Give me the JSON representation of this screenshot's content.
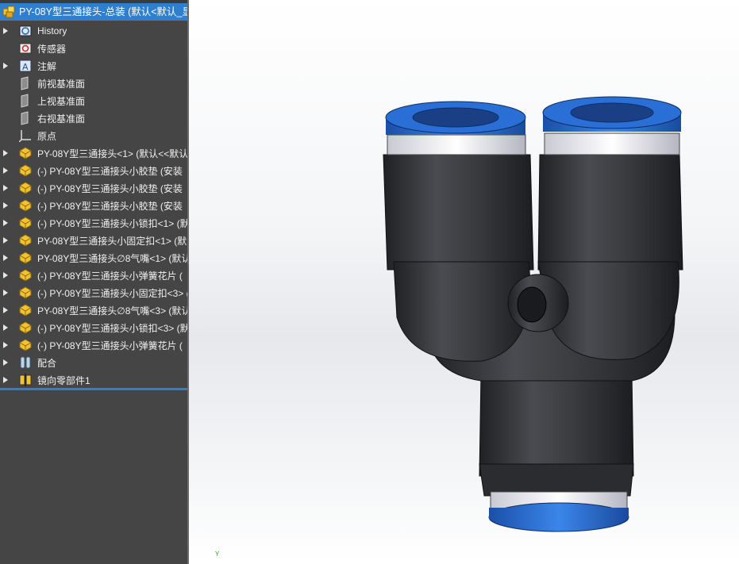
{
  "feature_tree": {
    "title": "PY-08Y型三通接头-总装 (默认<默认_显",
    "items": [
      {
        "label": "History",
        "icon": "history-icon",
        "expandable": true
      },
      {
        "label": "传感器",
        "icon": "sensor-icon",
        "expandable": false
      },
      {
        "label": "注解",
        "icon": "annotation-icon",
        "expandable": true
      },
      {
        "label": "前视基准面",
        "icon": "plane-icon",
        "expandable": false
      },
      {
        "label": "上视基准面",
        "icon": "plane-icon",
        "expandable": false
      },
      {
        "label": "右视基准面",
        "icon": "plane-icon",
        "expandable": false
      },
      {
        "label": "原点",
        "icon": "origin-icon",
        "expandable": false
      },
      {
        "label": "PY-08Y型三通接头<1> (默认<<默认",
        "icon": "part-icon",
        "expandable": true
      },
      {
        "label": "(-) PY-08Y型三通接头小胶垫 (安装",
        "icon": "part-icon",
        "expandable": true
      },
      {
        "label": "(-) PY-08Y型三通接头小胶垫 (安装",
        "icon": "part-icon",
        "expandable": true
      },
      {
        "label": "(-) PY-08Y型三通接头小胶垫 (安装",
        "icon": "part-icon",
        "expandable": true
      },
      {
        "label": "(-) PY-08Y型三通接头小锁扣<1> (默",
        "icon": "part-icon",
        "expandable": true
      },
      {
        "label": "PY-08Y型三通接头小固定扣<1> (默",
        "icon": "part-icon",
        "expandable": true
      },
      {
        "label": "PY-08Y型三通接头∅8气嘴<1> (默认",
        "icon": "part-icon",
        "expandable": true
      },
      {
        "label": "(-) PY-08Y型三通接头小弹簧花片 (",
        "icon": "part-icon",
        "expandable": true
      },
      {
        "label": "(-) PY-08Y型三通接头小固定扣<3> (",
        "icon": "part-icon",
        "expandable": true
      },
      {
        "label": "PY-08Y型三通接头∅8气嘴<3> (默认",
        "icon": "part-icon",
        "expandable": true
      },
      {
        "label": "(-) PY-08Y型三通接头小锁扣<3> (默",
        "icon": "part-icon",
        "expandable": true
      },
      {
        "label": "(-) PY-08Y型三通接头小弹簧花片 (",
        "icon": "part-icon",
        "expandable": true
      },
      {
        "label": "配合",
        "icon": "mates-icon",
        "expandable": true
      },
      {
        "label": "镜向零部件1",
        "icon": "mirror-component-icon",
        "expandable": true
      }
    ]
  },
  "viewport": {
    "triad_label": "Y",
    "colors": {
      "body": "#3a3b3f",
      "cap": "#2a6fd6",
      "ring": "#e8e8ee",
      "panel": "#454545",
      "accent": "#2f7fd0"
    }
  }
}
